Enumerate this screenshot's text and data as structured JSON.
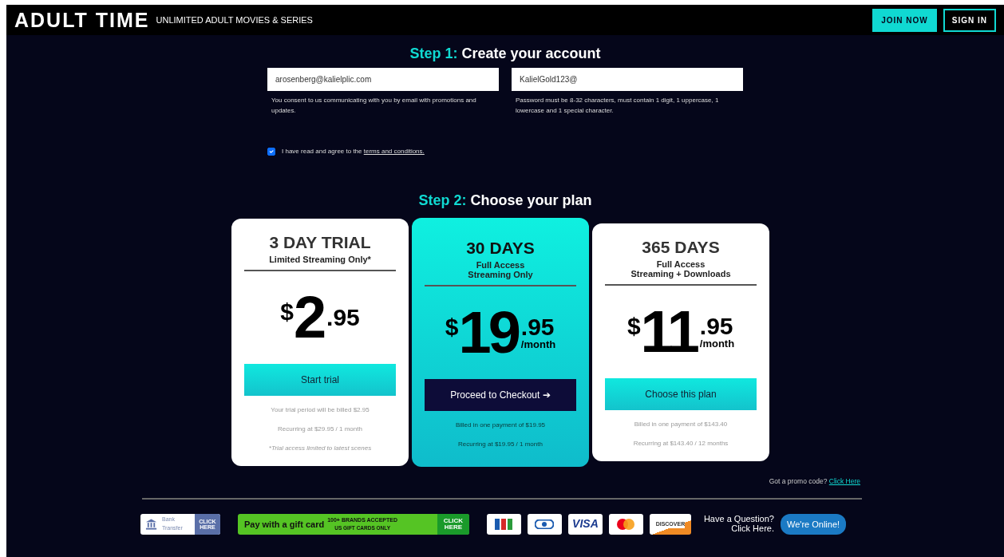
{
  "header": {
    "logo": "ADULT TIME",
    "tagline": "UNLIMITED ADULT MOVIES & SERIES",
    "buttons": [
      {
        "label": "JOIN NOW",
        "kind": "primary"
      },
      {
        "label": "SIGN IN",
        "kind": "outline"
      }
    ]
  },
  "step1": {
    "step": "Step 1:",
    "title": "Create your account",
    "fields": [
      {
        "value": "arosenberg@kalielplic.com",
        "help": "You consent to us communicating with you by email with promotions and updates."
      },
      {
        "value": "KalielGold123@",
        "help": "Password must be 8-32 characters, must contain 1 digit, 1 uppercase, 1 lowercase and 1 special character."
      }
    ],
    "agree": {
      "checked": true,
      "text": "I have read and agree to the ",
      "link": "terms and conditions."
    }
  },
  "step2": {
    "step": "Step 2:",
    "title": "Choose your plan"
  },
  "plans": [
    {
      "title": "3 DAY TRIAL",
      "subtitle": [
        "Limited Streaming Only*"
      ],
      "currency": "$",
      "dollars": "2",
      "cents": ".95",
      "selected": false,
      "button": "Start trial",
      "notes": [
        {
          "text": "Your trial period will be billed $2.95",
          "kind": "plain"
        },
        {
          "text": "Recurring at $29.95 / 1 month",
          "kind": "plain"
        },
        {
          "text": "*Trial access limited to latest scenes",
          "kind": "italic"
        }
      ]
    },
    {
      "title": "30 DAYS",
      "subtitle": [
        "Full Access",
        "Streaming Only"
      ],
      "currency": "$",
      "dollars": "19",
      "cents": ".95",
      "period": "/month",
      "selected": true,
      "button": "Proceed to Checkout",
      "button_arrow": "➔",
      "notes": [
        {
          "text": "Billed in one payment of $19.95",
          "kind": "plain"
        },
        {
          "text": "Recurring at $19.95 / 1 month",
          "kind": "plain"
        }
      ]
    },
    {
      "title": "365 DAYS",
      "subtitle": [
        "Full Access",
        "Streaming + Downloads"
      ],
      "currency": "$",
      "dollars": "11",
      "cents": ".95",
      "period": "/month",
      "selected": false,
      "button": "Choose this plan",
      "notes": [
        {
          "text": "Billed in one payment of $143.40",
          "kind": "plain"
        },
        {
          "text": "Recurring at $143.40 / 12 months",
          "kind": "plain"
        }
      ]
    }
  ],
  "promo": {
    "text": "Got a promo code?",
    "link": "Click Here"
  },
  "payments": [
    {
      "kind": "bank",
      "label": "Bank Transfer",
      "action": "CLICK HERE"
    },
    {
      "kind": "gift",
      "label": "Pay with a gift card",
      "note": "100+ BRANDS ACCEPTED",
      "subnote": "US GIFT CARDS ONLY",
      "action": "CLICK HERE"
    },
    {
      "kind": "jcb"
    },
    {
      "kind": "diners"
    },
    {
      "kind": "visa",
      "label": "VISA"
    },
    {
      "kind": "mastercard"
    },
    {
      "kind": "discover",
      "label": "DISCOVER"
    }
  ],
  "help": {
    "question": "Have a Question?",
    "action": "Click Here.",
    "chat": "We're Online!"
  }
}
